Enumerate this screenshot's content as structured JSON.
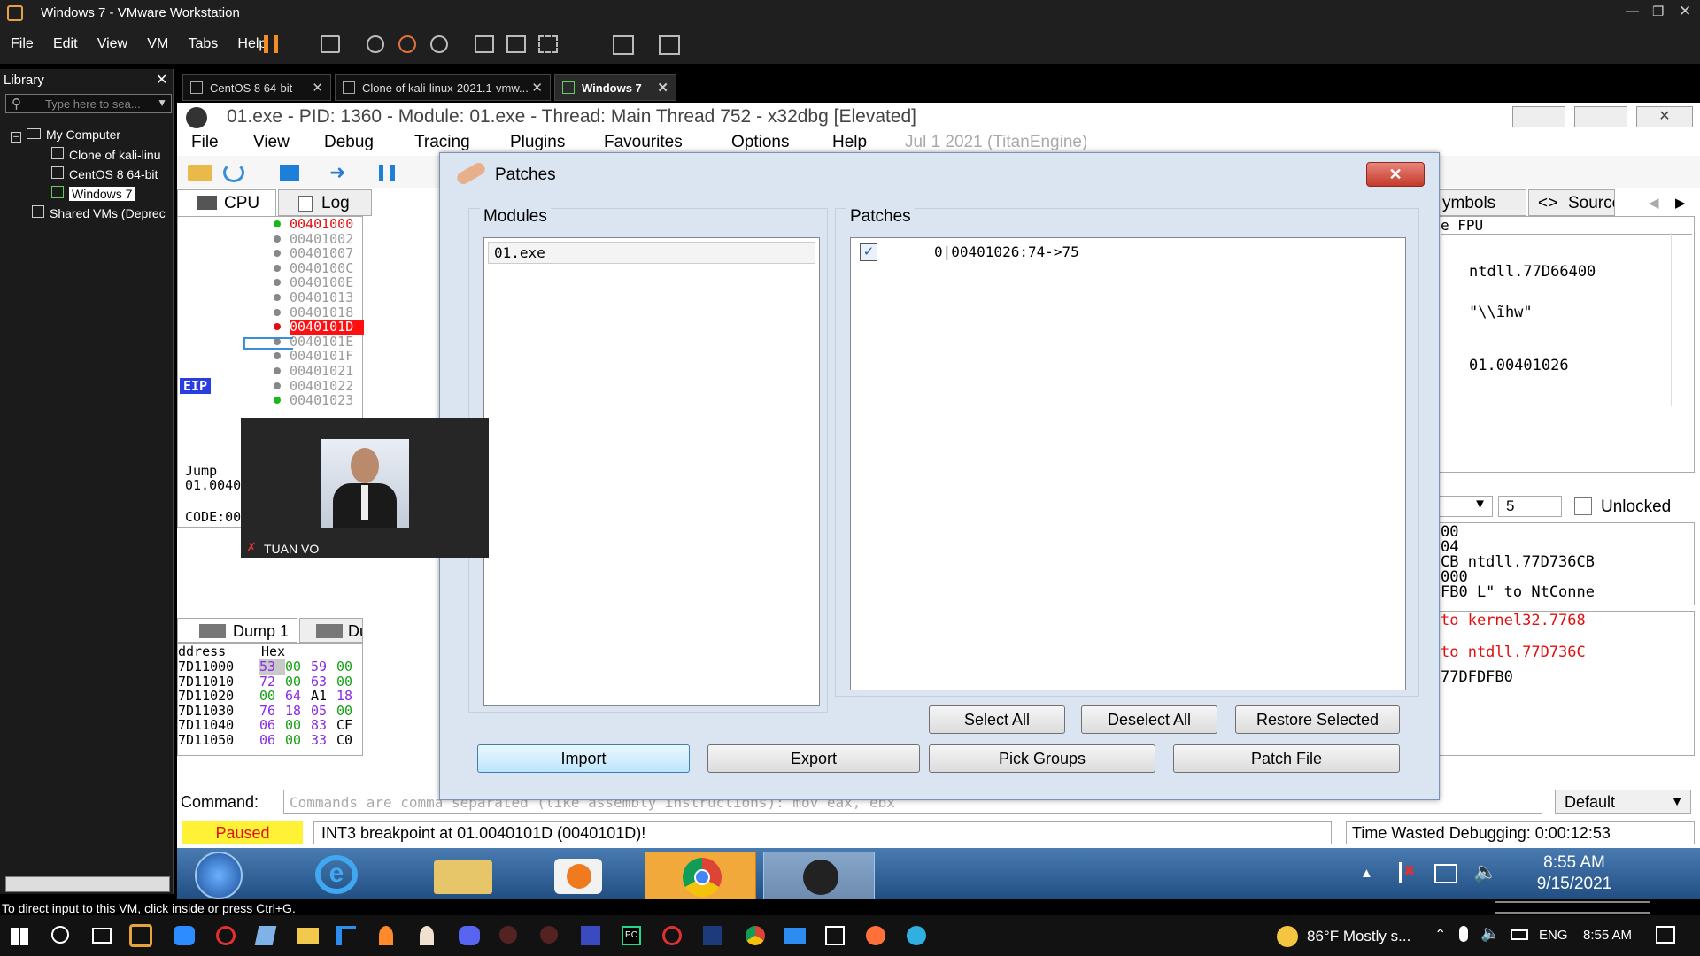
{
  "vm": {
    "title": "Windows 7 - VMware Workstation",
    "menu": [
      "File",
      "Edit",
      "View",
      "VM",
      "Tabs",
      "Help"
    ],
    "status_bar": "To direct input to this VM, click inside or press Ctrl+G."
  },
  "library": {
    "title": "Library",
    "search_placeholder": "Type here to sea...",
    "tree": [
      "My Computer",
      "Clone of kali-linu",
      "CentOS 8 64-bit",
      "Windows 7",
      "Shared VMs (Deprec"
    ]
  },
  "vm_tabs": [
    "CentOS 8 64-bit",
    "Clone of kali-linux-2021.1-vmw...",
    "Windows 7"
  ],
  "x64dbg": {
    "title": "01.exe - PID: 1360 - Module: 01.exe - Thread: Main Thread 752 - x32dbg [Elevated]",
    "menu": [
      "File",
      "View",
      "Debug",
      "Tracing",
      "Plugins",
      "Favourites",
      "Options",
      "Help",
      "Jul 1 2021 (TitanEngine)"
    ],
    "tabs_left": [
      "CPU",
      "Log"
    ],
    "tabs_right": [
      "ymbols",
      "Source"
    ],
    "addresses": [
      "00401000",
      "00401002",
      "00401007",
      "0040100C",
      "0040100E",
      "00401013",
      "00401018",
      "0040101D",
      "0040101E",
      "0040101F",
      "00401021",
      "00401022",
      "00401023"
    ],
    "eip": "EIP",
    "info_lines": [
      "Jump",
      "01.0040103D",
      "",
      "CODE:00401026 01.ex"
    ],
    "dump_tabs": [
      "Dump 1",
      "Dump"
    ],
    "dump_header": [
      "ddress",
      "Hex"
    ],
    "dump_rows": [
      {
        "addr": "7D11000",
        "hex": [
          "53",
          "00",
          "59",
          "00"
        ]
      },
      {
        "addr": "7D11010",
        "hex": [
          "72",
          "00",
          "63",
          "00"
        ]
      },
      {
        "addr": "7D11020",
        "hex": [
          "00",
          "64",
          "A1",
          "18"
        ]
      },
      {
        "addr": "7D11030",
        "hex": [
          "76",
          "18",
          "05",
          "00"
        ]
      },
      {
        "addr": "7D11040",
        "hex": [
          "06",
          "00",
          "83",
          "CF"
        ]
      },
      {
        "addr": "7D11050",
        "hex": [
          "06",
          "00",
          "33",
          "C0"
        ]
      }
    ],
    "right_panel": {
      "fpu": "e FPU",
      "values": [
        "ntdll.77D66400",
        "\"\\\\ĩhw\"",
        "01.00401026"
      ],
      "spin_value": "5",
      "unlocked": "Unlocked",
      "stack_lines": [
        "00",
        "04",
        "CB ntdll.77D736CB",
        "000",
        "FB0 L\" to NtConne"
      ],
      "red_lines": [
        "to kernel32.7768",
        "to ntdll.77D736C"
      ],
      "last_line": "77DFDFB0"
    },
    "command_label": "Command:",
    "command_placeholder": "Commands are comma separated (like assembly instructions): mov eax, ebx",
    "default_select": "Default",
    "status_paused": "Paused",
    "status_msg": "INT3 breakpoint at 01.0040101D (0040101D)!",
    "time_wasted": "Time Wasted Debugging: 0:00:12:53"
  },
  "patches": {
    "title": "Patches",
    "modules_label": "Modules",
    "patches_label": "Patches",
    "module_item": "01.exe",
    "patch_item": "0|00401026:74->75",
    "btn_select_all": "Select All",
    "btn_deselect_all": "Deselect All",
    "btn_restore_selected": "Restore Selected",
    "btn_import": "Import",
    "btn_export": "Export",
    "btn_pick_groups": "Pick Groups",
    "btn_patch_file": "Patch File"
  },
  "webcam": {
    "name": "TUAN VO"
  },
  "guest_clock": {
    "time": "8:55 AM",
    "date": "9/15/2021"
  },
  "host_tray": {
    "weather": "86°F  Mostly s...",
    "lang": "ENG",
    "time": "8:55 AM"
  }
}
